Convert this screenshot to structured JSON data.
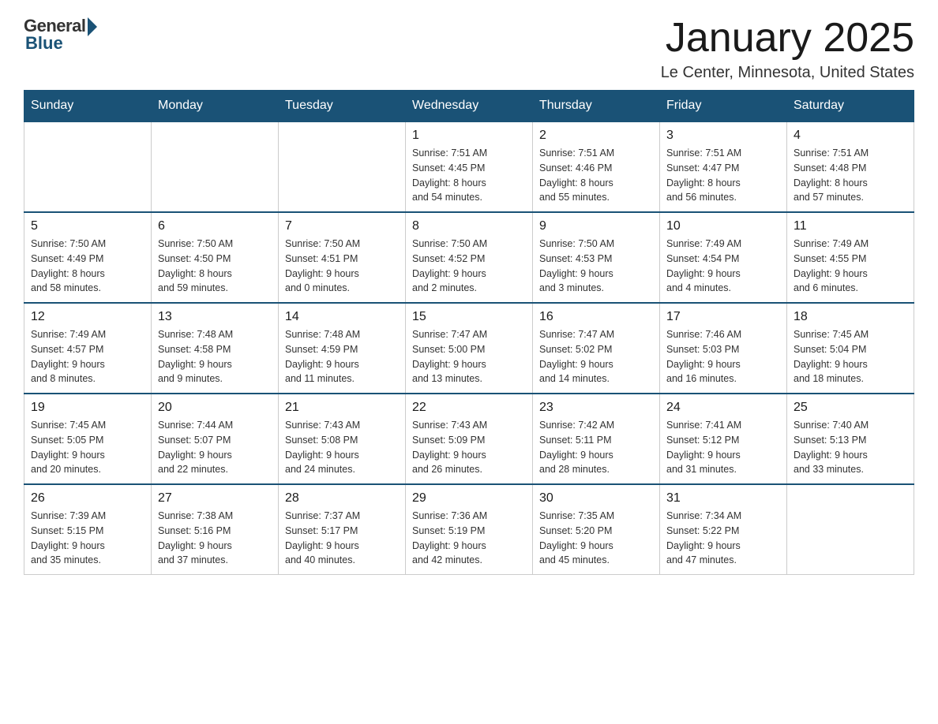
{
  "header": {
    "logo_general": "General",
    "logo_blue": "Blue",
    "month_title": "January 2025",
    "location": "Le Center, Minnesota, United States"
  },
  "days_of_week": [
    "Sunday",
    "Monday",
    "Tuesday",
    "Wednesday",
    "Thursday",
    "Friday",
    "Saturday"
  ],
  "weeks": [
    [
      {
        "day": "",
        "info": ""
      },
      {
        "day": "",
        "info": ""
      },
      {
        "day": "",
        "info": ""
      },
      {
        "day": "1",
        "info": "Sunrise: 7:51 AM\nSunset: 4:45 PM\nDaylight: 8 hours\nand 54 minutes."
      },
      {
        "day": "2",
        "info": "Sunrise: 7:51 AM\nSunset: 4:46 PM\nDaylight: 8 hours\nand 55 minutes."
      },
      {
        "day": "3",
        "info": "Sunrise: 7:51 AM\nSunset: 4:47 PM\nDaylight: 8 hours\nand 56 minutes."
      },
      {
        "day": "4",
        "info": "Sunrise: 7:51 AM\nSunset: 4:48 PM\nDaylight: 8 hours\nand 57 minutes."
      }
    ],
    [
      {
        "day": "5",
        "info": "Sunrise: 7:50 AM\nSunset: 4:49 PM\nDaylight: 8 hours\nand 58 minutes."
      },
      {
        "day": "6",
        "info": "Sunrise: 7:50 AM\nSunset: 4:50 PM\nDaylight: 8 hours\nand 59 minutes."
      },
      {
        "day": "7",
        "info": "Sunrise: 7:50 AM\nSunset: 4:51 PM\nDaylight: 9 hours\nand 0 minutes."
      },
      {
        "day": "8",
        "info": "Sunrise: 7:50 AM\nSunset: 4:52 PM\nDaylight: 9 hours\nand 2 minutes."
      },
      {
        "day": "9",
        "info": "Sunrise: 7:50 AM\nSunset: 4:53 PM\nDaylight: 9 hours\nand 3 minutes."
      },
      {
        "day": "10",
        "info": "Sunrise: 7:49 AM\nSunset: 4:54 PM\nDaylight: 9 hours\nand 4 minutes."
      },
      {
        "day": "11",
        "info": "Sunrise: 7:49 AM\nSunset: 4:55 PM\nDaylight: 9 hours\nand 6 minutes."
      }
    ],
    [
      {
        "day": "12",
        "info": "Sunrise: 7:49 AM\nSunset: 4:57 PM\nDaylight: 9 hours\nand 8 minutes."
      },
      {
        "day": "13",
        "info": "Sunrise: 7:48 AM\nSunset: 4:58 PM\nDaylight: 9 hours\nand 9 minutes."
      },
      {
        "day": "14",
        "info": "Sunrise: 7:48 AM\nSunset: 4:59 PM\nDaylight: 9 hours\nand 11 minutes."
      },
      {
        "day": "15",
        "info": "Sunrise: 7:47 AM\nSunset: 5:00 PM\nDaylight: 9 hours\nand 13 minutes."
      },
      {
        "day": "16",
        "info": "Sunrise: 7:47 AM\nSunset: 5:02 PM\nDaylight: 9 hours\nand 14 minutes."
      },
      {
        "day": "17",
        "info": "Sunrise: 7:46 AM\nSunset: 5:03 PM\nDaylight: 9 hours\nand 16 minutes."
      },
      {
        "day": "18",
        "info": "Sunrise: 7:45 AM\nSunset: 5:04 PM\nDaylight: 9 hours\nand 18 minutes."
      }
    ],
    [
      {
        "day": "19",
        "info": "Sunrise: 7:45 AM\nSunset: 5:05 PM\nDaylight: 9 hours\nand 20 minutes."
      },
      {
        "day": "20",
        "info": "Sunrise: 7:44 AM\nSunset: 5:07 PM\nDaylight: 9 hours\nand 22 minutes."
      },
      {
        "day": "21",
        "info": "Sunrise: 7:43 AM\nSunset: 5:08 PM\nDaylight: 9 hours\nand 24 minutes."
      },
      {
        "day": "22",
        "info": "Sunrise: 7:43 AM\nSunset: 5:09 PM\nDaylight: 9 hours\nand 26 minutes."
      },
      {
        "day": "23",
        "info": "Sunrise: 7:42 AM\nSunset: 5:11 PM\nDaylight: 9 hours\nand 28 minutes."
      },
      {
        "day": "24",
        "info": "Sunrise: 7:41 AM\nSunset: 5:12 PM\nDaylight: 9 hours\nand 31 minutes."
      },
      {
        "day": "25",
        "info": "Sunrise: 7:40 AM\nSunset: 5:13 PM\nDaylight: 9 hours\nand 33 minutes."
      }
    ],
    [
      {
        "day": "26",
        "info": "Sunrise: 7:39 AM\nSunset: 5:15 PM\nDaylight: 9 hours\nand 35 minutes."
      },
      {
        "day": "27",
        "info": "Sunrise: 7:38 AM\nSunset: 5:16 PM\nDaylight: 9 hours\nand 37 minutes."
      },
      {
        "day": "28",
        "info": "Sunrise: 7:37 AM\nSunset: 5:17 PM\nDaylight: 9 hours\nand 40 minutes."
      },
      {
        "day": "29",
        "info": "Sunrise: 7:36 AM\nSunset: 5:19 PM\nDaylight: 9 hours\nand 42 minutes."
      },
      {
        "day": "30",
        "info": "Sunrise: 7:35 AM\nSunset: 5:20 PM\nDaylight: 9 hours\nand 45 minutes."
      },
      {
        "day": "31",
        "info": "Sunrise: 7:34 AM\nSunset: 5:22 PM\nDaylight: 9 hours\nand 47 minutes."
      },
      {
        "day": "",
        "info": ""
      }
    ]
  ]
}
